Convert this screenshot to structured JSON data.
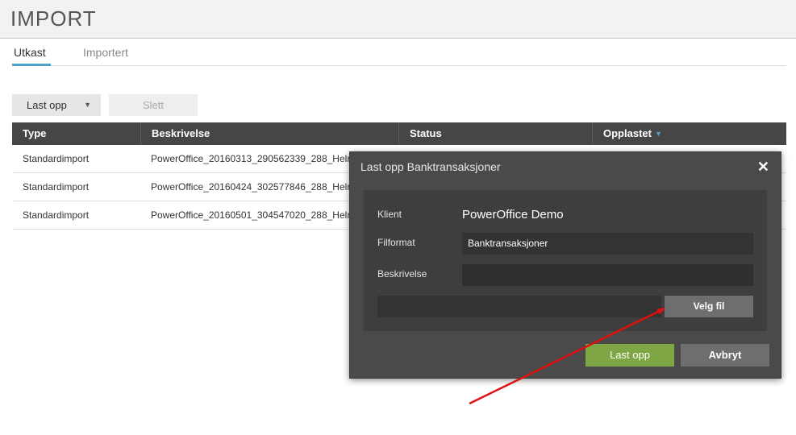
{
  "page": {
    "title": "IMPORT"
  },
  "tabs": [
    {
      "label": "Utkast",
      "active": true
    },
    {
      "label": "Importert",
      "active": false
    }
  ],
  "toolbar": {
    "upload_label": "Last opp",
    "delete_label": "Slett"
  },
  "grid": {
    "columns": [
      "Type",
      "Beskrivelse",
      "Status",
      "Opplastet"
    ],
    "sort_column": "Opplastet",
    "rows": [
      {
        "type": "Standardimport",
        "description": "PowerOffice_20160313_290562339_288_Helr"
      },
      {
        "type": "Standardimport",
        "description": "PowerOffice_20160424_302577846_288_Helr"
      },
      {
        "type": "Standardimport",
        "description": "PowerOffice_20160501_304547020_288_Helr"
      }
    ]
  },
  "modal": {
    "title": "Last opp Banktransaksjoner",
    "client_label": "Klient",
    "client_value": "PowerOffice Demo",
    "format_label": "Filformat",
    "format_value": "Banktransaksjoner",
    "description_label": "Beskrivelse",
    "description_value": "",
    "file_path_value": "",
    "browse_label": "Velg fil",
    "submit_label": "Last opp",
    "cancel_label": "Avbryt"
  },
  "colors": {
    "accent": "#4aa3c9",
    "submit": "#7ea644",
    "annotation_arrow": "#e01010"
  }
}
